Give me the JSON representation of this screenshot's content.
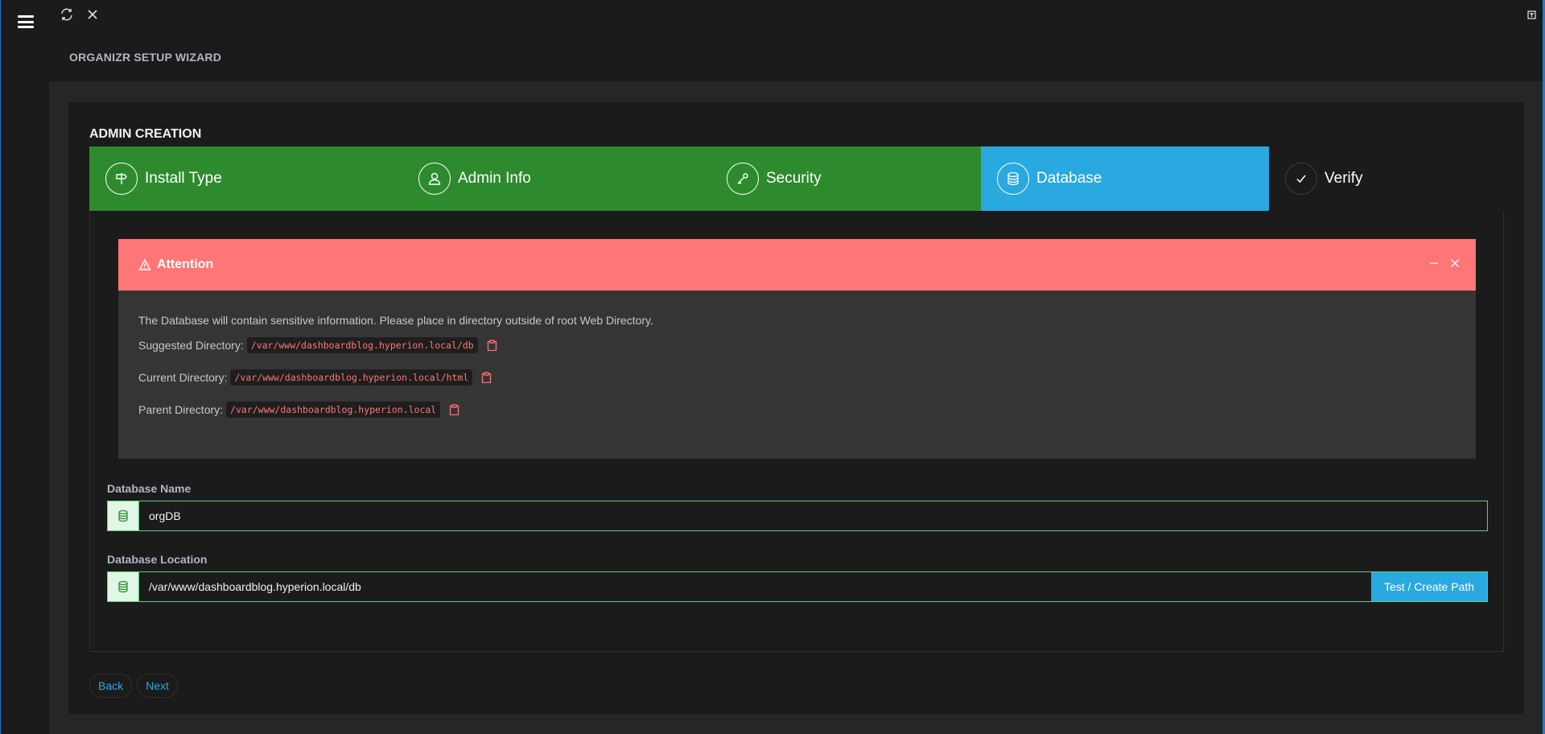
{
  "header": {
    "title": "ORGANIZR SETUP WIZARD"
  },
  "card": {
    "title": "ADMIN CREATION"
  },
  "steps": [
    {
      "label": "Install Type",
      "state": "done",
      "icon": "signpost-icon"
    },
    {
      "label": "Admin Info",
      "state": "done",
      "icon": "user-icon"
    },
    {
      "label": "Security",
      "state": "done",
      "icon": "key-icon"
    },
    {
      "label": "Database",
      "state": "active",
      "icon": "database-icon"
    },
    {
      "label": "Verify",
      "state": "todo",
      "icon": "check-icon"
    }
  ],
  "alert": {
    "title": "Attention",
    "message": "The Database will contain sensitive information. Please place in directory outside of root Web Directory.",
    "suggested_label": "Suggested Directory:",
    "suggested_path": "/var/www/dashboardblog.hyperion.local/db",
    "current_label": "Current Directory:",
    "current_path": "/var/www/dashboardblog.hyperion.local/html",
    "parent_label": "Parent Directory:",
    "parent_path": "/var/www/dashboardblog.hyperion.local"
  },
  "form": {
    "db_name_label": "Database Name",
    "db_name_value": "orgDB",
    "db_location_label": "Database Location",
    "db_location_value": "/var/www/dashboardblog.hyperion.local/db",
    "test_button": "Test / Create Path"
  },
  "nav": {
    "back": "Back",
    "next": "Next"
  },
  "colors": {
    "done": "#2d8b2d",
    "active": "#2aa8e0",
    "alert": "#ff7676",
    "background": "#1f1f1f"
  }
}
